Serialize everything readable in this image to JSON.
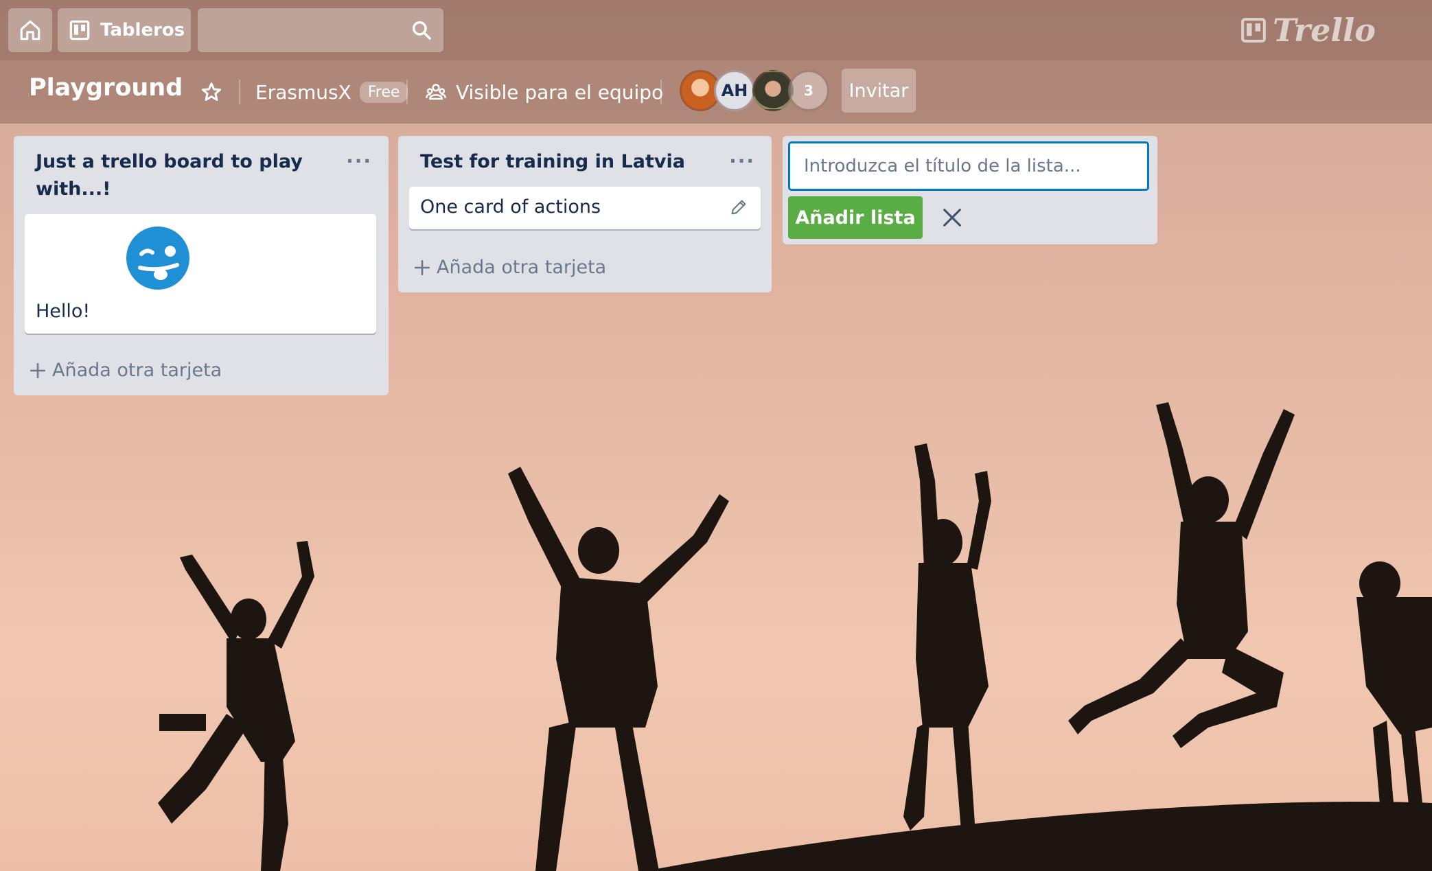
{
  "nav": {
    "home_icon": "home-icon",
    "boards_label": "Tableros",
    "boards_icon": "board-icon",
    "search_icon": "search-icon",
    "logo_text": "Trello"
  },
  "board": {
    "title": "Playground",
    "star_icon": "star-icon",
    "team_name": "ErasmusX",
    "team_badge": "Free",
    "visibility_icon": "team-visibility-icon",
    "visibility_label": "Visible para el equipo",
    "members": [
      {
        "type": "photo"
      },
      {
        "initials": "AH"
      },
      {
        "type": "photo"
      },
      {
        "count": "3"
      }
    ],
    "invite_label": "Invitar"
  },
  "lists": [
    {
      "title": "Just a trello board to play with...!",
      "menu": "···",
      "cards": [
        {
          "text": "Hello!",
          "cover": "winking-tongue-emoji"
        }
      ],
      "add_card_label": "Añada otra tarjeta"
    },
    {
      "title": "Test for training in Latvia",
      "menu": "···",
      "cards": [
        {
          "text": "One card of actions",
          "icon": "pencil-icon"
        }
      ],
      "add_card_label": "Añada otra tarjeta"
    }
  ],
  "new_list": {
    "placeholder": "Introduzca el título de la lista...",
    "value": "",
    "add_label": "Añadir lista",
    "close_icon": "close-icon"
  },
  "colors": {
    "accent_blue": "#0079bf",
    "add_green": "#5aac44",
    "list_bg": "#dfe1e6",
    "text_dark": "#172b4d"
  }
}
